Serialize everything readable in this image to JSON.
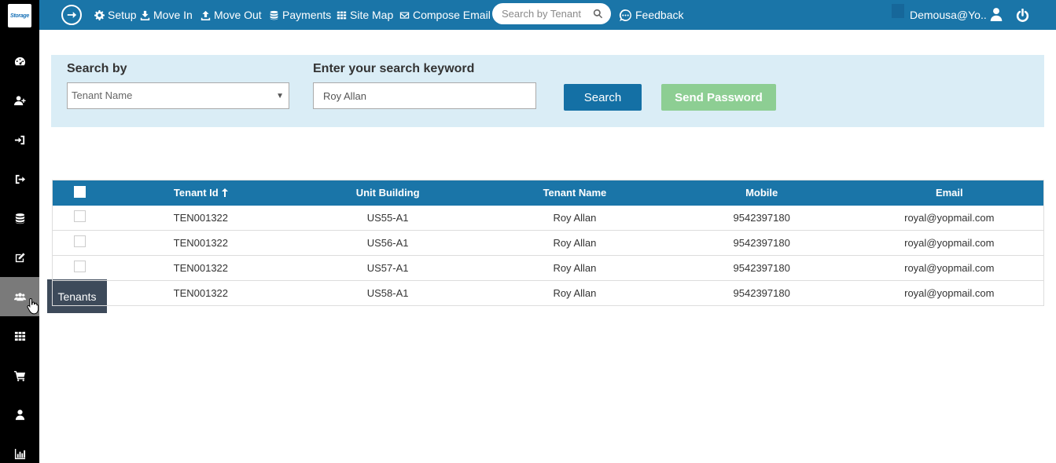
{
  "logo": {
    "text": "Storage"
  },
  "sidebar": {
    "items": [
      {
        "name": "dashboard",
        "icon": "dashboard-icon"
      },
      {
        "name": "move-in",
        "icon": "user-plus-icon"
      },
      {
        "name": "sign-in",
        "icon": "sign-in-icon"
      },
      {
        "name": "sign-out",
        "icon": "sign-out-icon"
      },
      {
        "name": "payments",
        "icon": "database-icon"
      },
      {
        "name": "compose",
        "icon": "edit-icon"
      },
      {
        "name": "tenants",
        "icon": "users-icon",
        "active": true
      },
      {
        "name": "site-map",
        "icon": "grid-icon"
      },
      {
        "name": "cart",
        "icon": "cart-icon"
      },
      {
        "name": "profile",
        "icon": "user-icon"
      },
      {
        "name": "reports",
        "icon": "bar-chart-icon"
      }
    ],
    "tooltip": "Tenants"
  },
  "topbar": {
    "nav": [
      {
        "label": "Setup",
        "icon": "gear-icon"
      },
      {
        "label": "Move In",
        "icon": "move-in-icon"
      },
      {
        "label": "Move Out",
        "icon": "move-out-icon"
      },
      {
        "label": "Payments",
        "icon": "database-icon"
      },
      {
        "label": "Site Map",
        "icon": "grid-icon"
      },
      {
        "label": "Compose Email",
        "icon": "envelope-icon"
      }
    ],
    "search_placeholder": "Search by Tenant",
    "feedback_label": "Feedback",
    "user_label": "Demousa@Yo..",
    "bar_color": "#1a75a8"
  },
  "search_panel": {
    "search_by_label": "Search by",
    "search_by_value": "Tenant Name",
    "keyword_label": "Enter your search keyword",
    "keyword_value": "Roy Allan",
    "search_button": "Search",
    "send_password_button": "Send Password"
  },
  "table": {
    "headers": [
      "Tenant Id",
      "Unit Building",
      "Tenant Name",
      "Mobile",
      "Email"
    ],
    "rows": [
      {
        "tenant_id": "TEN001322",
        "unit_building": "US55-A1",
        "tenant_name": "Roy Allan",
        "mobile": "9542397180",
        "email": "royal@yopmail.com"
      },
      {
        "tenant_id": "TEN001322",
        "unit_building": "US56-A1",
        "tenant_name": "Roy Allan",
        "mobile": "9542397180",
        "email": "royal@yopmail.com"
      },
      {
        "tenant_id": "TEN001322",
        "unit_building": "US57-A1",
        "tenant_name": "Roy Allan",
        "mobile": "9542397180",
        "email": "royal@yopmail.com"
      },
      {
        "tenant_id": "TEN001322",
        "unit_building": "US58-A1",
        "tenant_name": "Roy Allan",
        "mobile": "9542397180",
        "email": "royal@yopmail.com"
      }
    ]
  }
}
